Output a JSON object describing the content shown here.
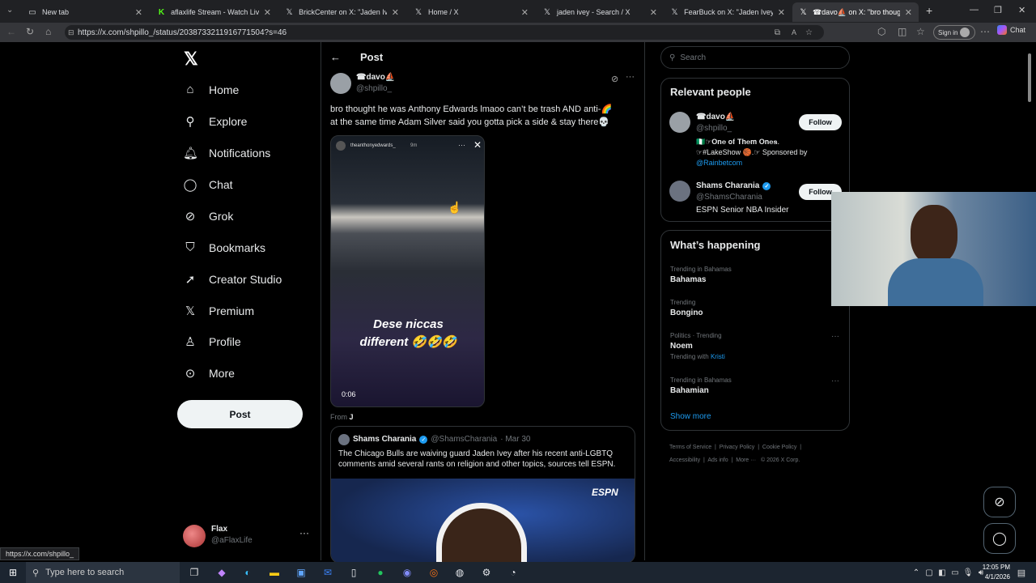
{
  "browser": {
    "tabs": [
      {
        "label": "New tab",
        "icon": "page-icon"
      },
      {
        "label": "aflaxlife Stream - Watch Live on K",
        "icon": "kick-icon"
      },
      {
        "label": "BrickCenter on X: \"Jaden Ivey on X",
        "icon": "x-icon"
      },
      {
        "label": "Home / X",
        "icon": "x-icon"
      },
      {
        "label": "jaden ivey - Search / X",
        "icon": "x-icon"
      },
      {
        "label": "FearBuck on X: \"Jaden Ivey questi",
        "icon": "x-icon"
      },
      {
        "label": "☎davo⛵ on X: \"bro thought he w",
        "icon": "x-icon"
      }
    ],
    "url": "https://x.com/shpillo_/status/2038733211916771504?s=46",
    "signin_label": "Sign in",
    "chat_label": "Chat",
    "status_url": "https://x.com/shpillo_"
  },
  "nav": {
    "items": [
      {
        "label": "Home",
        "icon": "home-icon"
      },
      {
        "label": "Explore",
        "icon": "search-icon"
      },
      {
        "label": "Notifications",
        "icon": "bell-icon"
      },
      {
        "label": "Chat",
        "icon": "chat-icon"
      },
      {
        "label": "Grok",
        "icon": "grok-icon"
      },
      {
        "label": "Bookmarks",
        "icon": "bookmark-icon"
      },
      {
        "label": "Creator Studio",
        "icon": "rocket-icon"
      },
      {
        "label": "Premium",
        "icon": "x-icon"
      },
      {
        "label": "Profile",
        "icon": "person-icon"
      },
      {
        "label": "More",
        "icon": "more-circle-icon"
      }
    ],
    "post_button": "Post",
    "account": {
      "name": "Flax",
      "handle": "@aFlaxLife"
    }
  },
  "post": {
    "header_title": "Post",
    "author_name": "☎davo⛵",
    "author_handle": "@shpillo_",
    "text_line1": "bro thought he was Anthony Edwards lmaoo can’t be trash AND anti-🌈",
    "text_line2": "at the same time Adam Silver said you gotta pick a side & stay there💀",
    "video": {
      "story_user": "theanthonyedwards_",
      "story_time": "9m",
      "caption_line1": "Dese niccas",
      "caption_line2": "different 🤣🤣🤣",
      "duration": "0:06"
    },
    "from_label": "From",
    "from_user": "J",
    "quote": {
      "name": "Shams Charania",
      "handle": "@ShamsCharania",
      "date": "· Mar 30",
      "text_line1": "The Chicago Bulls are waiving guard Jaden Ivey after his recent anti-LGBTQ",
      "text_line2": "comments amid several rants on religion and other topics, sources tell ESPN.",
      "image_brand": "ESPN"
    }
  },
  "sidebar": {
    "search_placeholder": "Search",
    "relevant_title": "Relevant people",
    "people": [
      {
        "name": "☎davo⛵",
        "handle": "@shpillo_",
        "bio_line1": "🇳🇬☞𝐎𝐧𝐞 𝐨𝐟 𝐓𝐡𝐞𝐦 𝐎𝐧𝐞𝐬.",
        "bio_line2": "☞#LakeShow 🏀.☞ Sponsored by",
        "bio_link": "@Rainbetcom",
        "follow": "Follow"
      },
      {
        "name": "Shams Charania",
        "handle": "@ShamsCharania",
        "bio_line1": "ESPN Senior NBA Insider",
        "follow": "Follow"
      }
    ],
    "happening_title": "What’s happening",
    "trends": [
      {
        "context": "Trending in Bahamas",
        "topic": "Bahamas",
        "extra": ""
      },
      {
        "context": "Trending",
        "topic": "Bongino",
        "extra": ""
      },
      {
        "context": "Politics · Trending",
        "topic": "Noem",
        "extra": "Trending with",
        "extra_link": "Kristi"
      },
      {
        "context": "Trending in Bahamas",
        "topic": "Bahamian",
        "extra": ""
      }
    ],
    "show_more": "Show more",
    "footer": [
      "Terms of Service",
      "Privacy Policy",
      "Cookie Policy",
      "Accessibility",
      "Ads info",
      "More ···",
      "© 2026 X Corp."
    ]
  },
  "taskbar": {
    "search_placeholder": "Type here to search",
    "time": "12:05 PM",
    "date": "4/1/2026"
  },
  "colors": {
    "accent": "#1d9bf0",
    "background": "#000000",
    "border": "#2f3336"
  }
}
